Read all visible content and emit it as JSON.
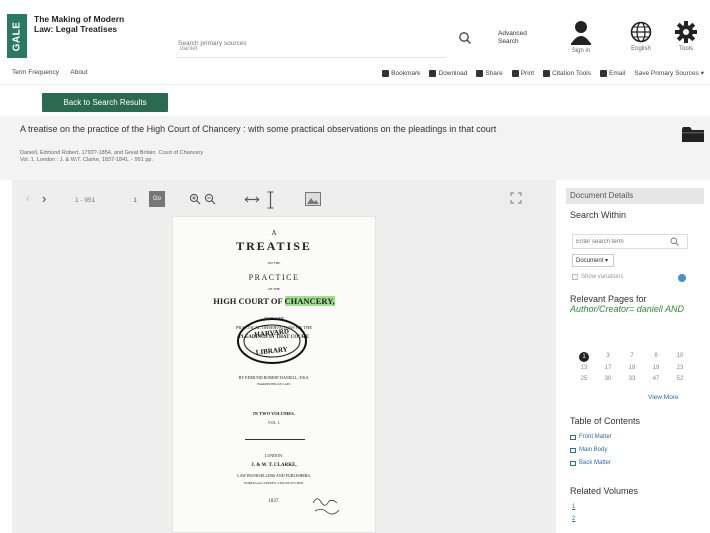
{
  "header": {
    "logo": "GALE",
    "product_title": "The Making of Modern Law: Legal Treatises",
    "search_placeholder": "Search primary sources",
    "search_hint": "daniel",
    "advanced_search": "Advanced Search",
    "sign_in": "Sign in",
    "language": "English",
    "tools": "Tools"
  },
  "nav": {
    "left": [
      "Term Frequency",
      "About"
    ],
    "right": [
      {
        "icon": "bookmark-icon",
        "label": "Bookmark"
      },
      {
        "icon": "download-icon",
        "label": "Download"
      },
      {
        "icon": "share-icon",
        "label": "Share"
      },
      {
        "icon": "print-icon",
        "label": "Print"
      },
      {
        "icon": "citation-icon",
        "label": "Citation Tools"
      },
      {
        "icon": "email-icon",
        "label": "Email"
      },
      {
        "icon": "save-icon",
        "label": "Save Primary Sources ▾"
      }
    ]
  },
  "back_button": "Back to Search Results",
  "document": {
    "title": "A treatise on the practice of the High Court of Chancery : with some practical observations on the pleadings in that court",
    "meta_line1": "Daniell, Edmund Robert, 1793?-1854, and Great Britain. Court of Chancery",
    "meta_line2": "Vol. 1. London : J. & W.T. Clarke, 1837-1841. - 951 pp."
  },
  "viewer": {
    "page_range": "1 - 951",
    "current_page": "1",
    "go_label": "Go",
    "page_text": {
      "line1": "A",
      "line2": "TREATISE",
      "line3": "ON THE",
      "line4": "PRACTICE",
      "line5": "OF THE",
      "line6_prefix": "HIGH COURT OF ",
      "line6_highlight": "CHANCERY,",
      "line7": "WITH SOME",
      "line8": "PRACTICAL OBSERVATIONS ON THE",
      "line9": "PLEADINGS IN THAT COURT.",
      "stamp_line1": "HARVARD",
      "stamp_line2": "LIBRARY",
      "line10": "BY EDMUND ROBERT DANIELL, F.R.S.",
      "line11": "BARRISTER AT LAW.",
      "line12": "IN TWO VOLUMES.",
      "line13": "VOL. I.",
      "line14": "LONDON:",
      "line15": "J. & W. T. CLARKE,",
      "line16": "LAW BOOKSELLERS AND PUBLISHERS,",
      "line17": "PORTUGAL STREET, LINCOLN'S-INN.",
      "line18": "1837."
    }
  },
  "panel": {
    "header": "Document Details",
    "search_within": "Search Within",
    "search_placeholder": "Enter search term",
    "scope_select": "Document ▾",
    "show_variations": "Show variations",
    "relevant_prefix": "Relevant Pages for",
    "relevant_query": "Author/Creator= daniell AND",
    "pages": [
      "1",
      "3",
      "7",
      "8",
      "10",
      "13",
      "17",
      "18",
      "19",
      "23",
      "25",
      "30",
      "33",
      "47",
      "52"
    ],
    "view_more": "View More",
    "toc_title": "Table of Contents",
    "toc": [
      "Front Matter",
      "Main Body",
      "Back Matter"
    ],
    "related_title": "Related Volumes",
    "related": [
      "1",
      "2"
    ]
  },
  "colors": {
    "brand": "#2a7a63",
    "back_button": "#2b6a52",
    "highlight": "#7ed67a",
    "link": "#2a6ab5"
  }
}
